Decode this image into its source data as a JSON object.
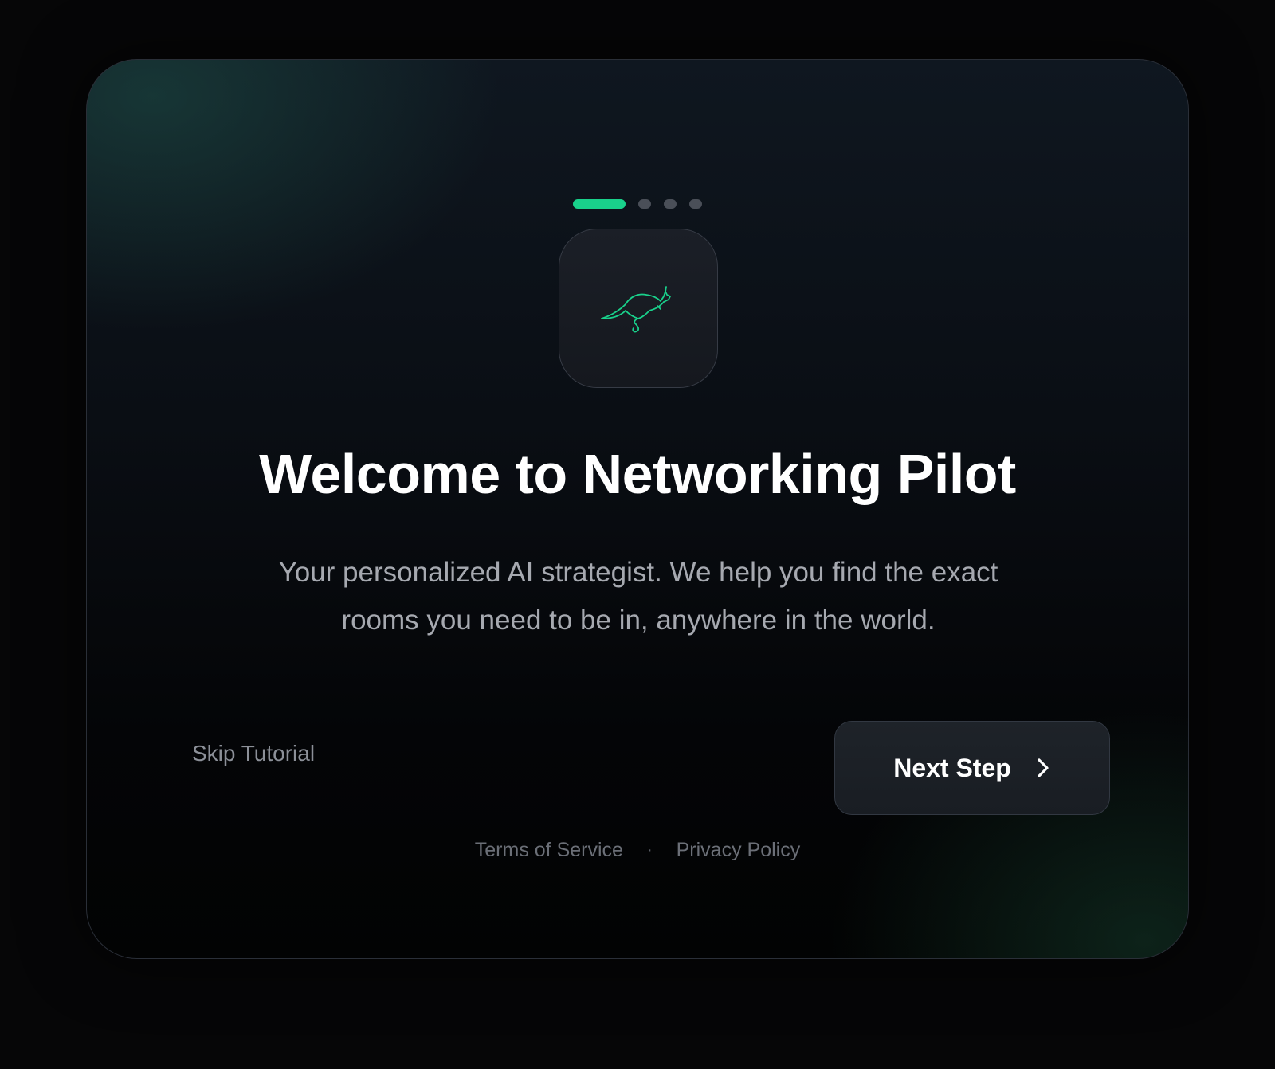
{
  "progress": {
    "current_step": 1,
    "total_steps": 4
  },
  "logo": {
    "icon": "kangaroo-icon",
    "color": "#19d18b"
  },
  "title": "Welcome to Networking Pilot",
  "subtitle": "Your personalized AI strategist. We help you find the exact rooms you need to be in, anywhere in the world.",
  "actions": {
    "skip_label": "Skip Tutorial",
    "next_label": "Next Step",
    "next_icon": "chevron-right-icon"
  },
  "footer": {
    "terms_label": "Terms of Service",
    "separator": "·",
    "privacy_label": "Privacy Policy"
  },
  "colors": {
    "accent": "#19d18b",
    "inactive_dot": "#4a4f58"
  }
}
